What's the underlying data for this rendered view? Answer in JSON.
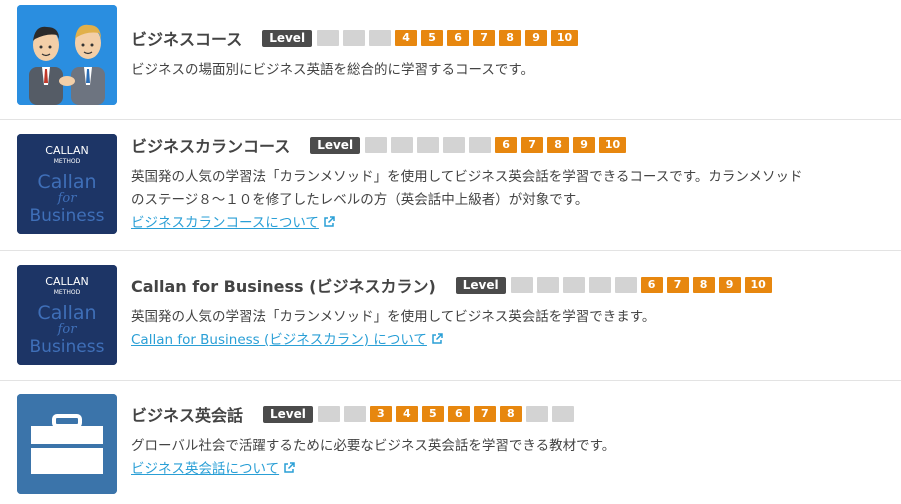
{
  "level_label": "Level",
  "courses": [
    {
      "title": "ビジネスコース",
      "levels": [
        "",
        "",
        "",
        "4",
        "5",
        "6",
        "7",
        "8",
        "9",
        "10"
      ],
      "description": "ビジネスの場面別にビジネス英語を総合的に学習するコースです。",
      "link": ""
    },
    {
      "title": "ビジネスカランコース",
      "levels": [
        "",
        "",
        "",
        "",
        "",
        "6",
        "7",
        "8",
        "9",
        "10"
      ],
      "description_line1": "英国発の人気の学習法「カランメソッド」を使用してビジネス英会話を学習できるコースです。カランメソッド",
      "description_line2": "のステージ８～１０を修了したレベルの方（英会話中上級者）が対象です。",
      "link": "ビジネスカランコースについて",
      "logo_text": [
        "CALLAN",
        "METHOD",
        "Callan",
        "for",
        "Business"
      ]
    },
    {
      "title": "Callan for Business (ビジネスカラン)",
      "levels": [
        "",
        "",
        "",
        "",
        "",
        "6",
        "7",
        "8",
        "9",
        "10"
      ],
      "description": "英国発の人気の学習法「カランメソッド」を使用してビジネス英会話を学習できます。",
      "link": "Callan for Business (ビジネスカラン) について",
      "logo_text": [
        "CALLAN",
        "METHOD",
        "Callan",
        "for",
        "Business"
      ]
    },
    {
      "title": "ビジネス英会話",
      "levels": [
        "",
        "",
        "3",
        "4",
        "5",
        "6",
        "7",
        "8",
        "",
        ""
      ],
      "description": "グローバル社会で活躍するために必要なビジネス英会話を学習できる教材です。",
      "link": "ビジネス英会話について"
    }
  ],
  "colors": {
    "level_on": "#e7870f",
    "level_off": "#d3d3d3",
    "link": "#2a9fd6",
    "briefcase_bg": "#3b74aa",
    "business_bg": "#2a8ee0",
    "callan_bg": "#1d3566"
  }
}
